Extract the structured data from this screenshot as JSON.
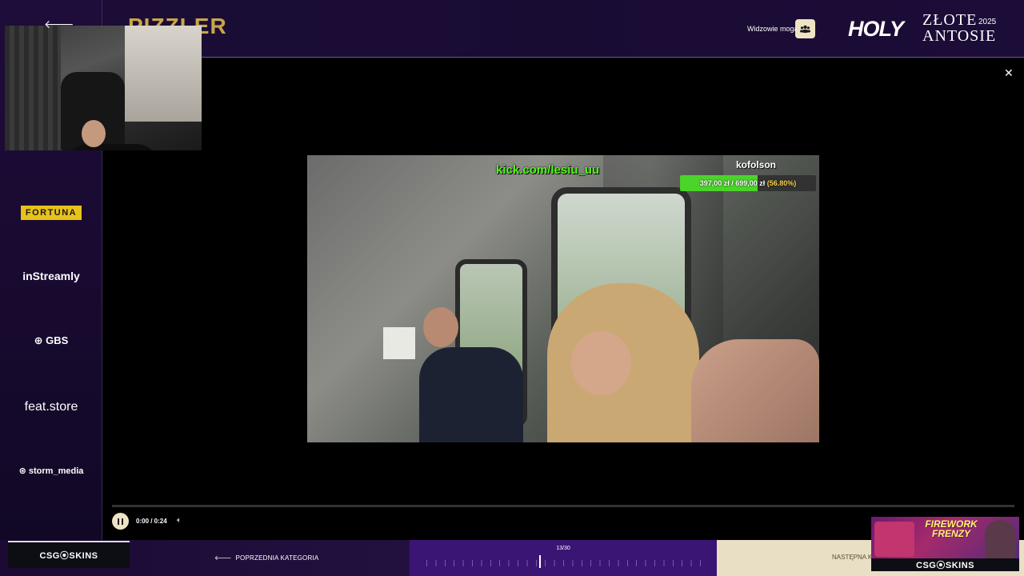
{
  "header": {
    "title": "PIZZLER",
    "viewers_label": "Widzowie mogą",
    "logo_holy": "HOLY",
    "logo_line1": "ZŁOTE",
    "logo_line2": "ANTOSIE",
    "logo_year": "2025"
  },
  "sidebar": {
    "sponsors": [
      "FORTUNA",
      "inStreamly",
      "GBS",
      "feat.store",
      "storm_media"
    ]
  },
  "video": {
    "overlay_url": "kick.com/lesiu_uu",
    "goal_name": "kofolson",
    "goal_text_amount": "397,00 zł / 699,00 zł",
    "goal_text_percent": "(56.80%)",
    "goal_progress_percent": 56.8,
    "time": "0:00 / 0:24",
    "playback_progress_percent": 0
  },
  "navigation": {
    "prev_label": "POPRZEDNIA KATEGORIA",
    "counter": "13/30",
    "next_label": "NASTĘPNA KA"
  },
  "ads": {
    "csgo_brand": "CSG⦿SKINS",
    "ad_title_line1": "FIREWORK",
    "ad_title_line2": "FRENZY"
  },
  "icons": {
    "back": "arrow-left-icon",
    "close": "close-icon",
    "viewers": "users-icon",
    "pause": "pause-icon",
    "volume": "volume-icon"
  },
  "colors": {
    "accent_gold": "#c9a64a",
    "kick_green": "#53fc18",
    "nav_purple": "#3b1574"
  }
}
